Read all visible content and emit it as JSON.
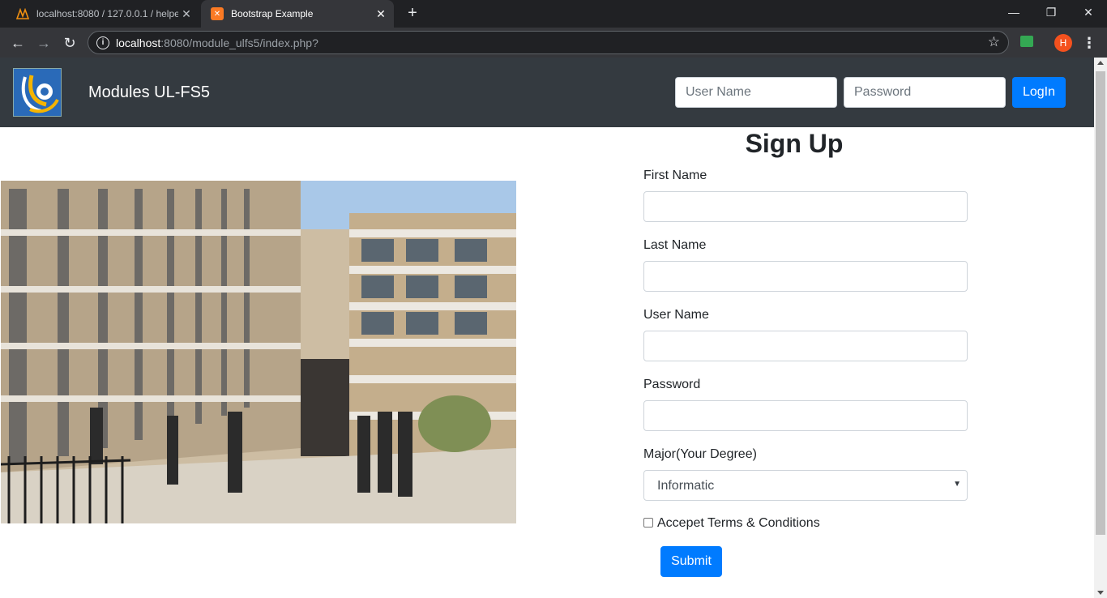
{
  "browser": {
    "tabs": [
      {
        "title": "localhost:8080 / 127.0.0.1 / helpe",
        "active": false,
        "icon": "phpmyadmin-icon"
      },
      {
        "title": "Bootstrap Example",
        "active": true,
        "icon": "xampp-icon"
      }
    ],
    "url_host": "localhost",
    "url_rest": ":8080/module_ulfs5/index.php?",
    "profile_initial": "H"
  },
  "navbar": {
    "brand": "Modules UL-FS5",
    "username_placeholder": "User Name",
    "password_placeholder": "Password",
    "login_label": "LogIn"
  },
  "signup": {
    "title": "Sign Up",
    "first_name_label": "First Name",
    "last_name_label": "Last Name",
    "username_label": "User Name",
    "password_label": "Password",
    "major_label": "Major(Your Degree)",
    "major_value": "Informatic",
    "terms_label": "Accepet Terms & Conditions",
    "submit_label": "Submit"
  },
  "colors": {
    "navbar_bg": "#343a40",
    "primary": "#007bff",
    "chrome_dark": "#202124"
  }
}
